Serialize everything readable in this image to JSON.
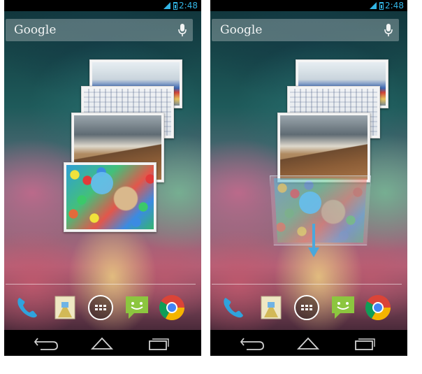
{
  "screens": [
    {
      "status_time": "2:48",
      "search": {
        "logo": "Google",
        "icon": "mic-icon"
      },
      "widget": {
        "name": "photo-stack-widget",
        "state": "touched"
      },
      "dock": [
        "phone-icon",
        "gallery-icon",
        "apps-grid-icon",
        "messaging-icon",
        "chrome-icon"
      ],
      "nav": [
        "back-icon",
        "home-icon",
        "recent-apps-icon"
      ]
    },
    {
      "status_time": "2:48",
      "search": {
        "logo": "Google",
        "icon": "mic-icon"
      },
      "widget": {
        "name": "photo-stack-widget",
        "state": "swiping-down"
      },
      "dock": [
        "phone-icon",
        "gallery-icon",
        "apps-grid-icon",
        "messaging-icon",
        "chrome-icon"
      ],
      "nav": [
        "back-icon",
        "home-icon",
        "recent-apps-icon"
      ]
    }
  ],
  "colors": {
    "accent": "#33b5e5",
    "touch_dot": "#66beee",
    "status_bar": "#000000"
  }
}
